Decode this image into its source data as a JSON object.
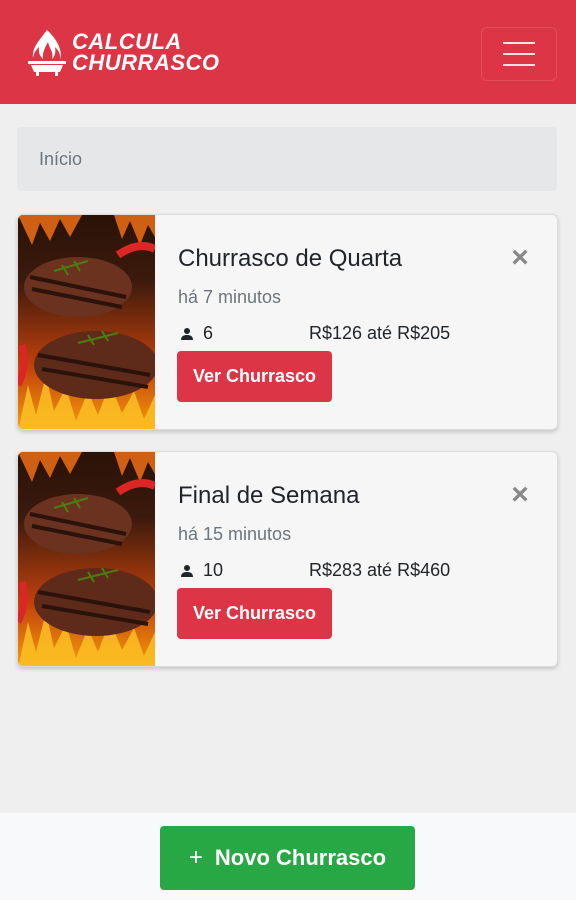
{
  "navbar": {
    "brand_line1": "CALCULA",
    "brand_line2": "CHURRASCO",
    "brand_color": "#dc3545",
    "logo_icon": "flame-grill-icon",
    "menu_icon": "hamburger-menu-icon"
  },
  "breadcrumb": {
    "label": "Início"
  },
  "cards": [
    {
      "title": "Churrasco de Quarta",
      "time": "há 7 minutos",
      "people": "6",
      "price": "R$126 até R$205",
      "button": "Ver Churrasco"
    },
    {
      "title": "Final de Semana",
      "time": "há 15 minutos",
      "people": "10",
      "price": "R$283 até R$460",
      "button": "Ver Churrasco"
    }
  ],
  "footer": {
    "new_button_label": "Novo Churrasco",
    "new_button_color": "#28a745"
  }
}
